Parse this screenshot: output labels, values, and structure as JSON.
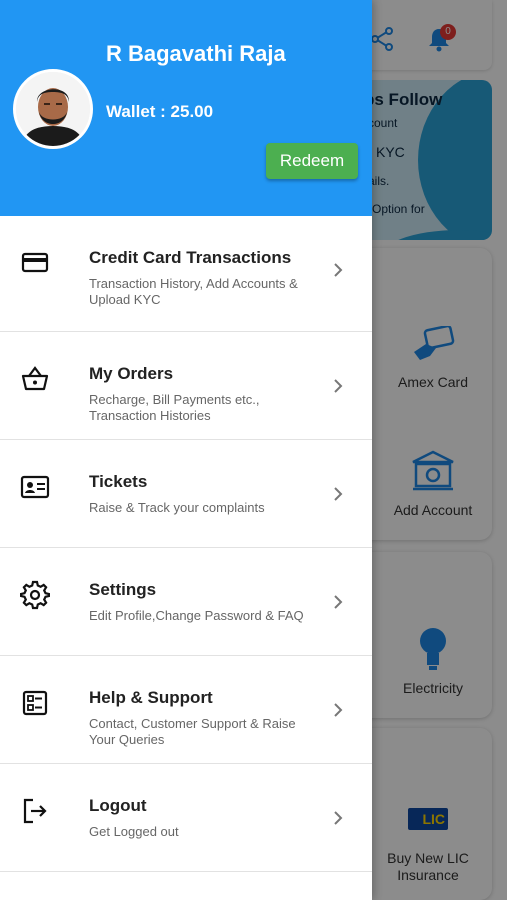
{
  "profile": {
    "name": "R Bagavathi Raja",
    "wallet_text": "Wallet : 25.00",
    "redeem_label": "Redeem"
  },
  "menu": [
    {
      "title": "Credit Card Transactions",
      "subtitle": "Transaction History, Add Accounts & Upload KYC",
      "icon": "credit-card-icon"
    },
    {
      "title": "My Orders",
      "subtitle": "Recharge, Bill Payments etc., Transaction Histories",
      "icon": "basket-icon"
    },
    {
      "title": "Tickets",
      "subtitle": "Raise & Track your complaints",
      "icon": "id-card-icon"
    },
    {
      "title": "Settings",
      "subtitle": "Edit Profile,Change Password & FAQ",
      "icon": "gear-icon"
    },
    {
      "title": "Help & Support",
      "subtitle": "Contact, Customer Support & Raise Your Queries",
      "icon": "support-list-icon"
    },
    {
      "title": "Logout",
      "subtitle": "Get Logged out",
      "icon": "logout-icon"
    }
  ],
  "background": {
    "notification_count": "0",
    "banner_lines": [
      "ps Follow",
      "count",
      "KYC",
      "ails.",
      "l Option for"
    ],
    "tiles": [
      "Amex Card",
      "Add Account",
      "Electricity",
      "Buy New LIC Insurance"
    ],
    "lic_logo_text": "LIC"
  },
  "colors": {
    "header": "#2196f3",
    "redeem": "#4caf50",
    "badge": "#e53935"
  }
}
